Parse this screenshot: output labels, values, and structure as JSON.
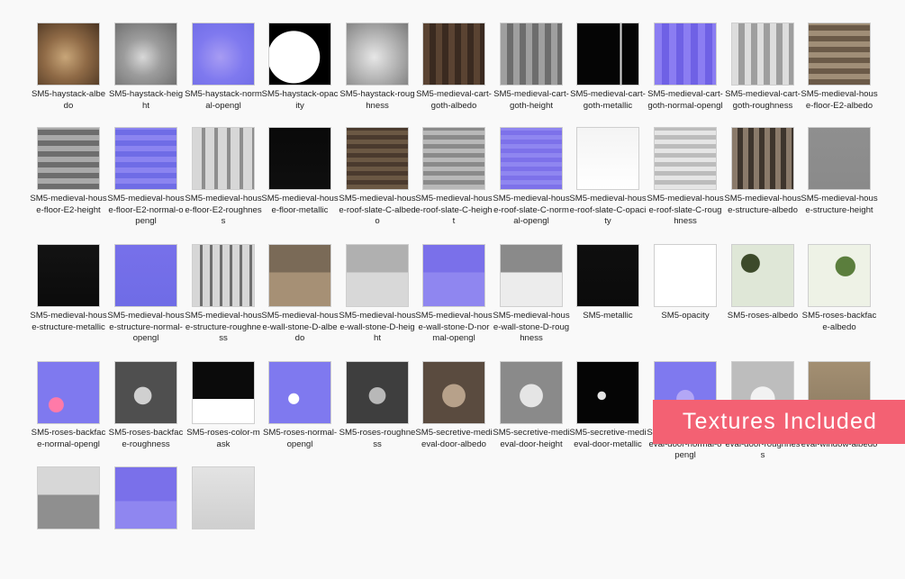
{
  "files": [
    {
      "name": "SM5-haystack-albedo",
      "thumb": "radial-gradient(circle at 45% 55%, #c8a679 0%, #8f6a46 45%, #4b3522 100%)"
    },
    {
      "name": "SM5-haystack-height",
      "thumb": "radial-gradient(circle at 45% 55%, #d8d8d8 0%, #9c9c9c 40%, #6a6a6a 100%)"
    },
    {
      "name": "SM5-haystack-normal-opengl",
      "thumb": "radial-gradient(circle at 45% 55%, #a79cf3 0%, #7f79ef 50%, #6f6ce6 100%)"
    },
    {
      "name": "SM5-haystack-opacity",
      "thumb": "radial-gradient(circle at 40% 55%, #ffffff 0%, #ffffff 52%, #000000 53%)"
    },
    {
      "name": "SM5-haystack-roughness",
      "thumb": "radial-gradient(circle at 45% 55%, #e7e7e7 0%, #b7b7b7 45%, #7b7b7b 100%)"
    },
    {
      "name": "SM5-medieval-cart-goth-albedo",
      "thumb": "repeating-linear-gradient(90deg, #5a4332 0 7px, #3a2a20 7px 14px)"
    },
    {
      "name": "SM5-medieval-cart-goth-height",
      "thumb": "repeating-linear-gradient(90deg, #9f9f9f 0 7px, #6d6d6d 7px 14px)"
    },
    {
      "name": "SM5-medieval-cart-goth-metallic",
      "thumb": "linear-gradient(90deg, #050505 0 70%, #d9d9d9 70% 73%, #050505 73%)"
    },
    {
      "name": "SM5-medieval-cart-goth-normal-opengl",
      "thumb": "repeating-linear-gradient(90deg, #8b7df2 0 8px, #6f61e5 8px 16px)"
    },
    {
      "name": "SM5-medieval-cart-goth-roughness",
      "thumb": "repeating-linear-gradient(90deg, #dddddd 0 7px, #9e9e9e 7px 14px)"
    },
    {
      "name": "SM5-medieval-house-floor-E2-albedo",
      "thumb": "repeating-linear-gradient(0deg, #6b5a48 0 6px, #a08e77 6px 12px)"
    },
    {
      "name": "SM5-medieval-house-floor-E2-height",
      "thumb": "repeating-linear-gradient(0deg, #6d6d6d 0 6px, #a9a9a9 6px 12px)"
    },
    {
      "name": "SM5-medieval-house-floor-E2-normal-opengl",
      "thumb": "repeating-linear-gradient(0deg, #6f6ce6 0 6px, #8b84f0 6px 12px)"
    },
    {
      "name": "SM5-medieval-house-floor-E2-roughness",
      "thumb": "repeating-linear-gradient(90deg, #d7d7d7 0 10px, #8e8e8e 10px 14px)"
    },
    {
      "name": "SM5-medieval-house-floor-metallic",
      "thumb": "linear-gradient(#090909, #0f0f0f)"
    },
    {
      "name": "SM5-medieval-house-roof-slate-C-albedo",
      "thumb": "repeating-linear-gradient(0deg, #6b5844 0 5px, #4a3a2e 5px 10px)"
    },
    {
      "name": "SM5-medieval-house-roof-slate-C-height",
      "thumb": "repeating-linear-gradient(0deg, #b8b8b8 0 5px, #8a8a8a 5px 10px)"
    },
    {
      "name": "SM5-medieval-house-roof-slate-C-normal-opengl",
      "thumb": "repeating-linear-gradient(0deg, #7d71ea 0 5px, #8f86f0 5px 10px)"
    },
    {
      "name": "SM5-medieval-house-roof-slate-C-opacity",
      "thumb": "linear-gradient(#f4f4f4, #ffffff)"
    },
    {
      "name": "SM5-medieval-house-roof-slate-C-roughness",
      "thumb": "repeating-linear-gradient(0deg, #e5e5e5 0 5px, #bcbcbc 5px 10px)"
    },
    {
      "name": "SM5-medieval-house-structure-albedo",
      "thumb": "repeating-linear-gradient(90deg, #8a7a6a 0 6px, #3e352d 6px 12px)"
    },
    {
      "name": "SM5-medieval-house-structure-height",
      "thumb": "linear-gradient(#8f8f8f, #8a8a8a)"
    },
    {
      "name": "SM5-medieval-house-structure-metallic",
      "thumb": "linear-gradient(#131313, #0b0b0b)"
    },
    {
      "name": "SM5-medieval-house-structure-normal-opengl",
      "thumb": "linear-gradient(#7770ea, #6f6ce6)"
    },
    {
      "name": "SM5-medieval-house-structure-roughness",
      "thumb": "repeating-linear-gradient(90deg, #d6d6d6 0 8px, #6e6e6e 8px 11px)"
    },
    {
      "name": "SM5-medieval-house-wall-stone-D-albedo",
      "thumb": "linear-gradient(#7a6a57 0 45%, #a69075 45% 100%)"
    },
    {
      "name": "SM5-medieval-house-wall-stone-D-height",
      "thumb": "linear-gradient(#b0b0b0 0 45%, #d8d8d8 45% 100%)"
    },
    {
      "name": "SM5-medieval-house-wall-stone-D-normal-opengl",
      "thumb": "linear-gradient(#7a70ea 0 45%, #8f86f0 45% 100%)"
    },
    {
      "name": "SM5-medieval-house-wall-stone-D-roughness",
      "thumb": "linear-gradient(#8a8a8a 0 45%, #ececec 45% 100%)"
    },
    {
      "name": "SM5-metallic",
      "thumb": "linear-gradient(#0f0f0f, #0b0b0b)"
    },
    {
      "name": "SM5-opacity",
      "thumb": "linear-gradient(#ffffff, #ffffff)"
    },
    {
      "name": "SM5-roses-albedo",
      "thumb": "radial-gradient(circle at 30% 30%, #3c4a2a 0 15%, #dfe7d7 16%), linear-gradient(#dfe7d7, #dfe7d7)"
    },
    {
      "name": "SM5-roses-backface-albedo",
      "thumb": "radial-gradient(circle at 60% 35%, #5b7e3d 0 18%, #eef2e6 19%), linear-gradient(#eef2e6, #eef2e6)"
    },
    {
      "name": "SM5-roses-backface-normal-opengl",
      "thumb": "radial-gradient(circle at 30% 70%, #ff7aa8 0 12%, #7f79ef 13%), linear-gradient(#7f79ef, #7f79ef)"
    },
    {
      "name": "SM5-roses-backface-roughness",
      "thumb": "radial-gradient(circle at 45% 55%, #d0d0d0 0 18%, #4f4f4f 19%), linear-gradient(#4f4f4f, #4f4f4f)"
    },
    {
      "name": "SM5-roses-color-mask",
      "thumb": "linear-gradient(#0b0b0b 0 60%, #ffffff 60% 100%)"
    },
    {
      "name": "SM5-roses-normal-opengl",
      "thumb": "radial-gradient(circle at 40% 60%, #ffffff 0 10%, #7f79ef 11%), linear-gradient(#7f79ef, #7f79ef)"
    },
    {
      "name": "SM5-roses-roughness",
      "thumb": "radial-gradient(circle at 50% 55%, #b8b8b8 0 18%, #3e3e3e 19%), linear-gradient(#3e3e3e, #3e3e3e)"
    },
    {
      "name": "SM5-secretive-medieval-door-albedo",
      "thumb": "radial-gradient(circle at 50% 55%, #b7a18a 0 25%, #5a4b3f 26%), linear-gradient(#5a4b3f, #5a4b3f)"
    },
    {
      "name": "SM5-secretive-medieval-door-height",
      "thumb": "radial-gradient(circle at 50% 55%, #e5e5e5 0 25%, #8a8a8a 26%), linear-gradient(#8a8a8a, #8a8a8a)"
    },
    {
      "name": "SM5-secretive-medieval-door-metallic",
      "thumb": "radial-gradient(circle at 40% 55%, #e5e5e5 0 8%, #050505 9%), linear-gradient(#050505, #050505)"
    },
    {
      "name": "SM5-secretive-medieval-door-normal-opengl",
      "thumb": "radial-gradient(circle at 50% 60%, #b3a7f6 0 18%, #7f79ef 19%), linear-gradient(#7f79ef, #7f79ef)"
    },
    {
      "name": "SM5-secretive-medieval-door-roughness",
      "thumb": "radial-gradient(circle at 50% 60%, #f2f2f2 0 25%, #bdbdbd 26%), linear-gradient(#bdbdbd, #bdbdbd)"
    },
    {
      "name": "SM5-secretive-medieval-window-albedo",
      "thumb": "linear-gradient(#a38f72, #8c7a61)"
    },
    {
      "name": "",
      "thumb": "linear-gradient(#d7d7d7 0 45%, #8f8f8f 45% 100%)"
    },
    {
      "name": "",
      "thumb": "linear-gradient(#7a70ea 0 55%, #8f86f0 55% 100%)"
    },
    {
      "name": "",
      "thumb": "linear-gradient(#e3e3e3, #cfcfcf)"
    }
  ],
  "labels_override": {
    "41": "SM5-secretive-medieval-door-normal-opengl",
    "42": "SM5-secretive-medieval-door-roughness",
    "43": "SM5-secretive-medieval-window-albedo"
  },
  "banner": {
    "text": "Textures Included",
    "bg": "#f36173",
    "fg": "#ffffff"
  },
  "colors": {
    "background": "#f9f9f9",
    "label": "#222222",
    "thumb_border": "#cfcfcf"
  }
}
